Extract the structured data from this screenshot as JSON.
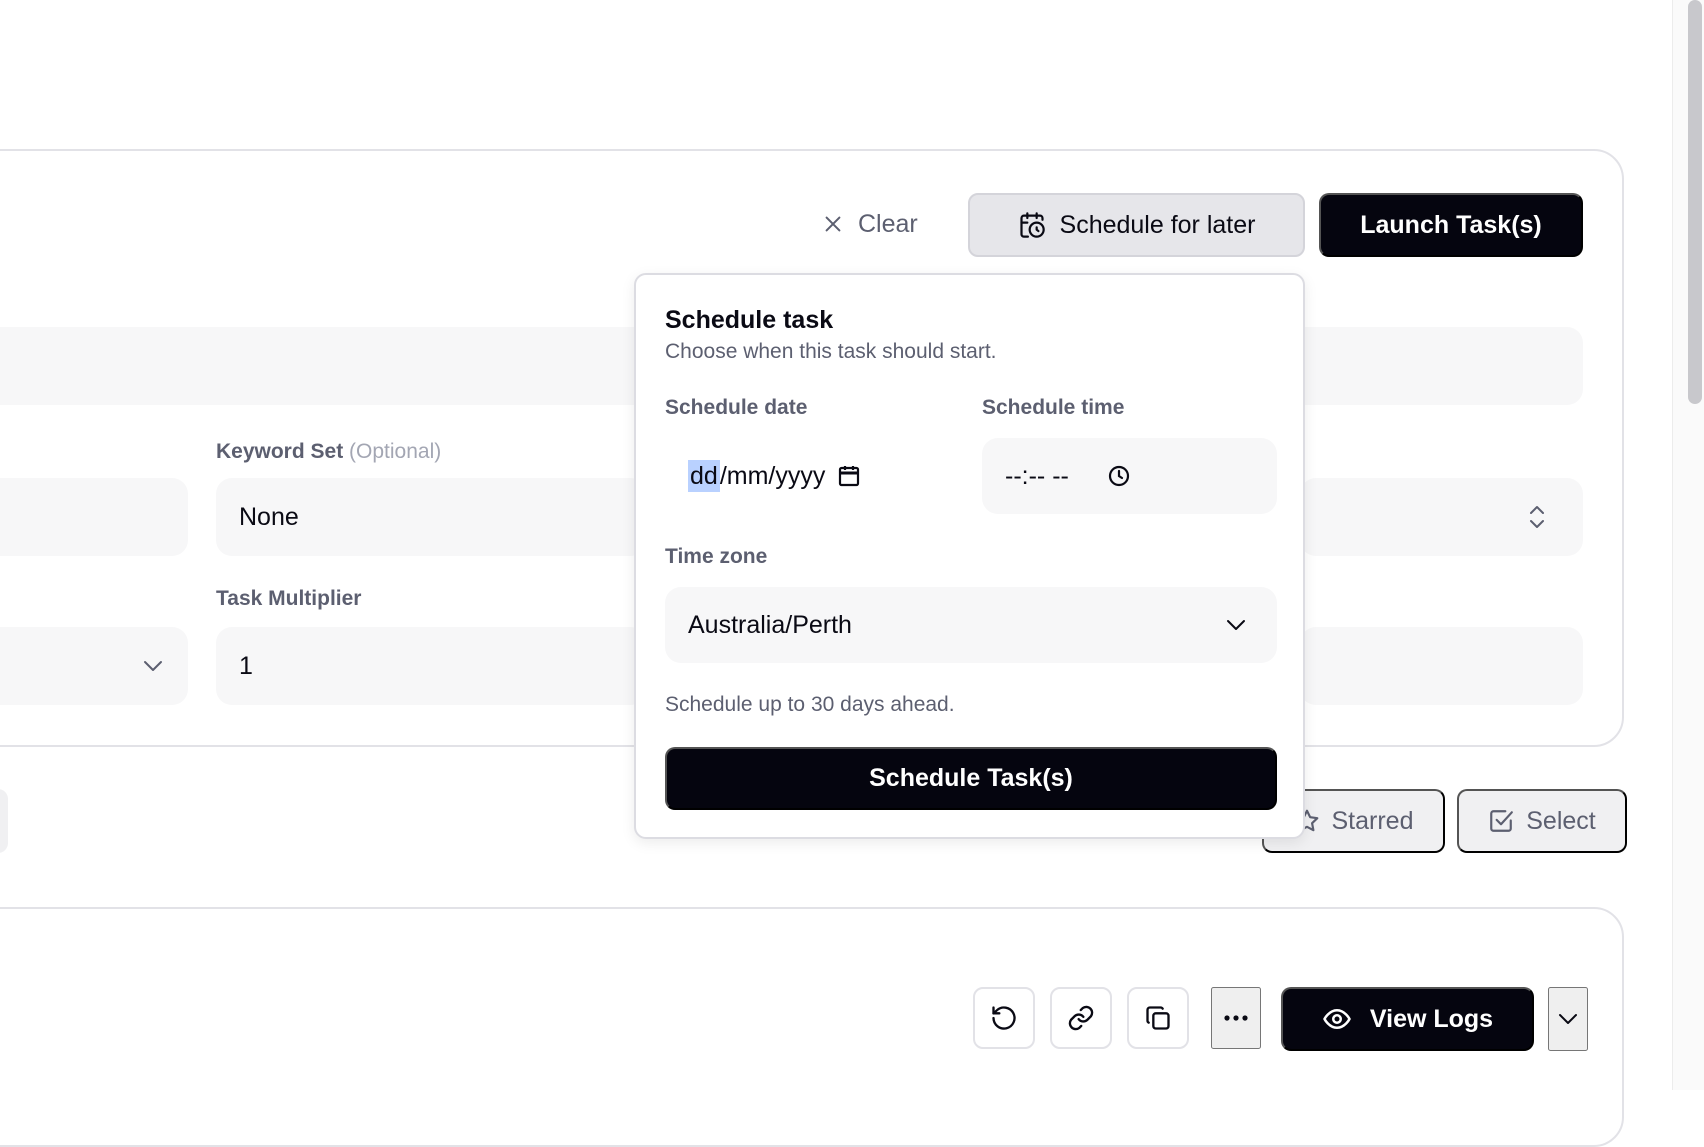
{
  "toolbar": {
    "clear_label": "Clear",
    "schedule_later_label": "Schedule for later",
    "launch_label": "Launch Task(s)"
  },
  "form": {
    "keyword_set_label": "Keyword Set",
    "keyword_set_optional": "(Optional)",
    "keyword_set_value": "None",
    "task_multiplier_label": "Task Multiplier",
    "task_multiplier_value": "1"
  },
  "filters": {
    "starred_label": "Starred",
    "select_label": "Select"
  },
  "row_actions": {
    "view_logs_label": "View Logs"
  },
  "schedule_popover": {
    "title": "Schedule task",
    "description": "Choose when this task should start.",
    "date_label": "Schedule date",
    "date_placeholder_day": "dd",
    "date_placeholder_rest": "/mm/yyyy",
    "time_label": "Schedule time",
    "time_placeholder": "--:-- --",
    "timezone_label": "Time zone",
    "timezone_value": "Australia/Perth",
    "hint": "Schedule up to 30 days ahead.",
    "submit_label": "Schedule Task(s)"
  },
  "colors": {
    "primary": "#05050f",
    "muted_text": "#5c5f70",
    "field_bg": "#f7f7f8",
    "border": "#e2e2e7",
    "date_highlight": "#b9d1ff"
  }
}
